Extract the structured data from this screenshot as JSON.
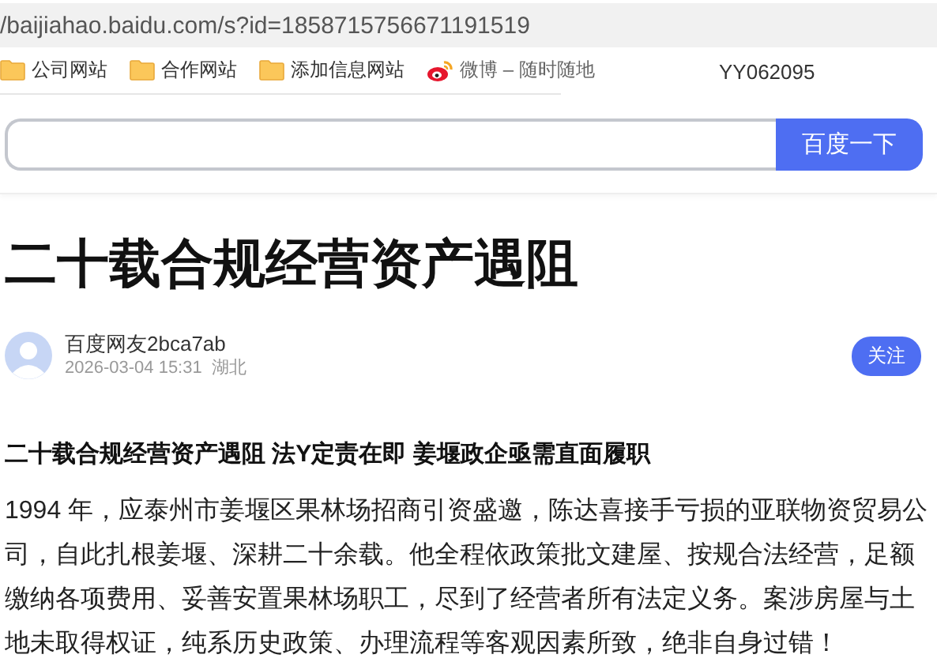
{
  "address_bar": {
    "url": "/baijiahao.baidu.com/s?id=1858715756671191519"
  },
  "bookmarks": [
    {
      "kind": "folder",
      "label": "公司网站"
    },
    {
      "kind": "folder",
      "label": "合作网站"
    },
    {
      "kind": "folder",
      "label": "添加信息网站"
    },
    {
      "kind": "weibo",
      "label": "微博 – 随时随地"
    }
  ],
  "bookmarks_right": "YY062095",
  "search": {
    "button": "百度一下"
  },
  "article": {
    "title": "二十载合规经营资产遇阻",
    "author": "百度网友2bca7ab",
    "date": "2026-03-04 15:31",
    "location": "湖北",
    "follow": "关注",
    "subheading": "二十载合规经营资产遇阻 法Y定责在即 姜堰政企亟需直面履职",
    "paragraph": "1994 年，应泰州市姜堰区果林场招商引资盛邀，陈达喜接手亏损的亚联物资贸易公司，自此扎根姜堰、深耕二十余载。他全程依政策批文建屋、按规合法经营，足额缴纳各项费用、妥善安置果林场职工，尽到了经营者所有法定义务。案涉房屋与土地未取得权证，纯系历史政策、办理流程等客观因素所致，绝非自身过错！"
  }
}
